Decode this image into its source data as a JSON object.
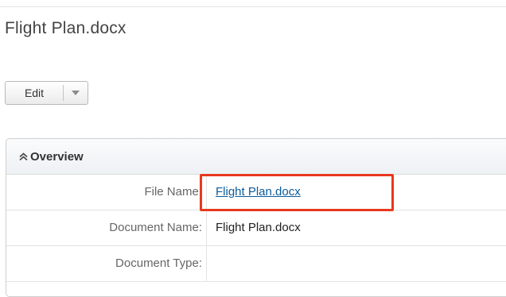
{
  "record": {
    "title": "Flight Plan.docx"
  },
  "actions": {
    "edit_label": "Edit",
    "dropdown_icon": "caret-down-icon"
  },
  "panel": {
    "title": "Overview",
    "toggle_icon": "double-chevron-up-icon",
    "fields": [
      {
        "label": "File Name:",
        "value": "Flight Plan.docx",
        "is_link": true
      },
      {
        "label": "Document Name:",
        "value": "Flight Plan.docx",
        "is_link": false
      },
      {
        "label": "Document Type:",
        "value": "",
        "is_link": false
      }
    ]
  },
  "colors": {
    "link": "#0b5b9b",
    "highlight": "#e8381e"
  }
}
